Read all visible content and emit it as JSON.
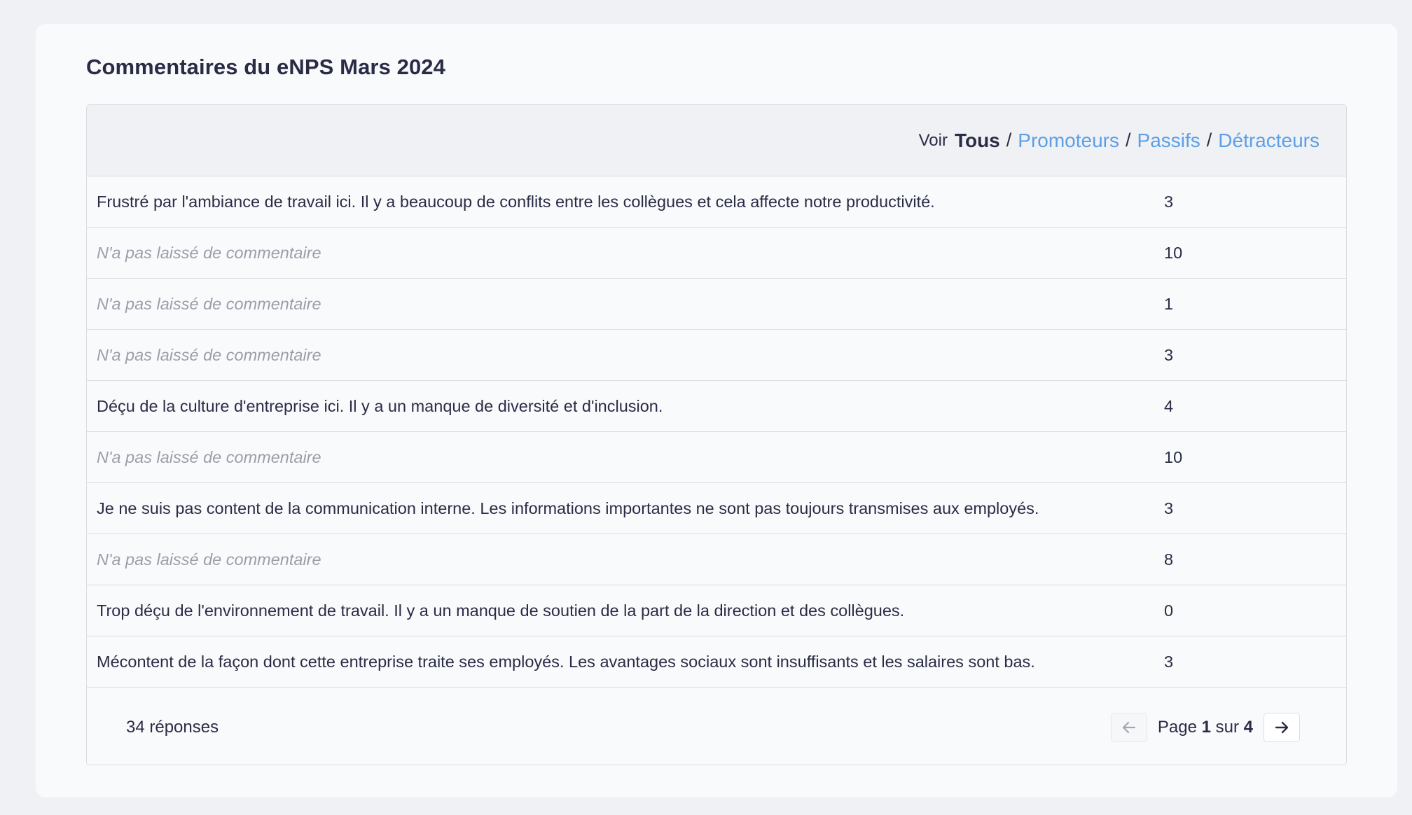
{
  "title": "Commentaires du eNPS Mars 2024",
  "filter": {
    "voir_label": "Voir",
    "active": "Tous",
    "separator": "/",
    "links": [
      "Promoteurs",
      "Passifs",
      "Détracteurs"
    ]
  },
  "rows": [
    {
      "comment": "Frustré par l'ambiance de travail ici. Il y a beaucoup de conflits entre les collègues et cela affecte notre productivité.",
      "score": "3",
      "empty": false
    },
    {
      "comment": "N'a pas laissé de commentaire",
      "score": "10",
      "empty": true
    },
    {
      "comment": "N'a pas laissé de commentaire",
      "score": "1",
      "empty": true
    },
    {
      "comment": "N'a pas laissé de commentaire",
      "score": "3",
      "empty": true
    },
    {
      "comment": "Déçu de la culture d'entreprise ici. Il y a un manque de diversité et d'inclusion.",
      "score": "4",
      "empty": false
    },
    {
      "comment": "N'a pas laissé de commentaire",
      "score": "10",
      "empty": true
    },
    {
      "comment": "Je ne suis pas content de la communication interne. Les informations importantes ne sont pas toujours transmises aux employés.",
      "score": "3",
      "empty": false
    },
    {
      "comment": "N'a pas laissé de commentaire",
      "score": "8",
      "empty": true
    },
    {
      "comment": "Trop déçu de l'environnement de travail. Il y a un manque de soutien de la part de la direction et des collègues.",
      "score": "0",
      "empty": false
    },
    {
      "comment": "Mécontent de la façon dont cette entreprise traite ses employés. Les avantages sociaux sont insuffisants et les salaires sont bas.",
      "score": "3",
      "empty": false
    }
  ],
  "footer": {
    "count_label": "34 réponses",
    "page_prefix": "Page",
    "page_current": "1",
    "page_of": "sur",
    "page_total": "4",
    "prev_icon": "arrow-left-icon",
    "next_icon": "arrow-right-icon"
  },
  "colors": {
    "background": "#f0f1f5",
    "card": "#f9fafc",
    "text": "#2a2c45",
    "link": "#5c9fe6",
    "muted": "#9b9eaa",
    "border": "#dcdde3"
  }
}
